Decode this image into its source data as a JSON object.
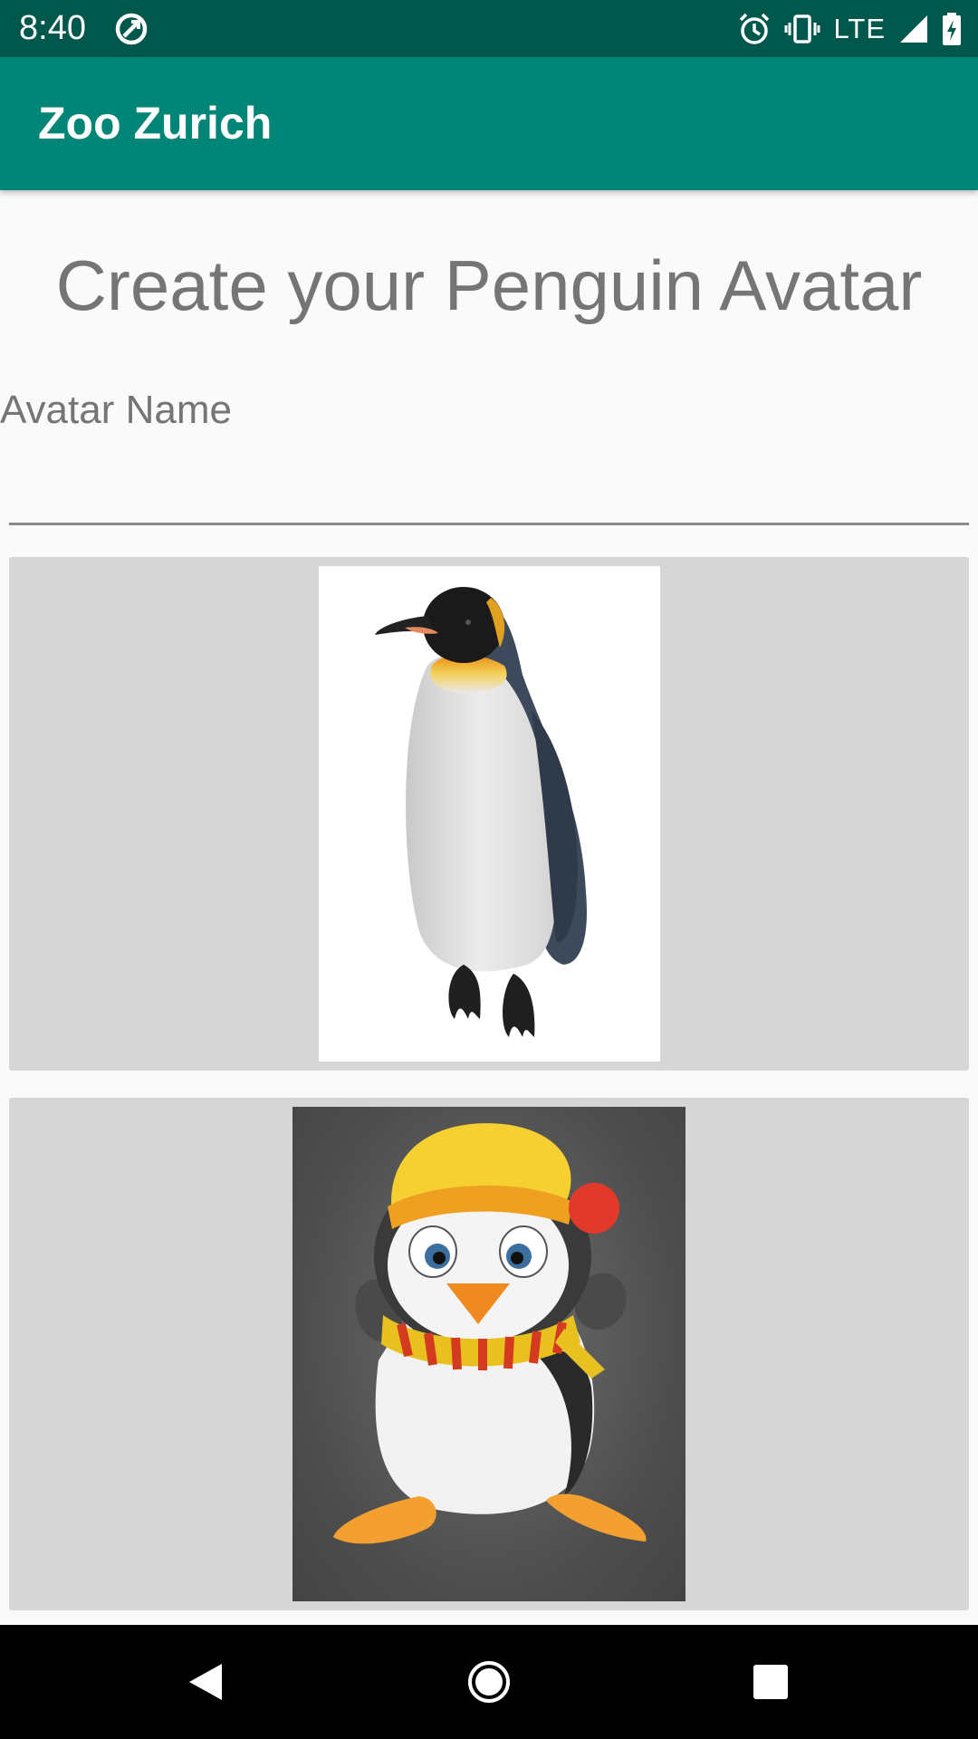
{
  "status_bar": {
    "time": "8:40",
    "network": "LTE",
    "icons": [
      "sync-icon",
      "alarm-icon",
      "vibrate-icon",
      "signal-icon",
      "battery-charging-icon"
    ]
  },
  "app_bar": {
    "title": "Zoo Zurich"
  },
  "main": {
    "heading": "Create your Penguin Avatar",
    "name_field": {
      "label": "Avatar Name",
      "value": ""
    },
    "avatars": [
      {
        "id": "emperor-penguin",
        "style": "realistic"
      },
      {
        "id": "cartoon-penguin",
        "style": "cartoon with hat and scarf"
      }
    ]
  },
  "nav_bar": {
    "buttons": [
      "back",
      "home",
      "recents"
    ]
  },
  "colors": {
    "status_bar": "#00574b",
    "app_bar": "#008577",
    "background": "#fafafa",
    "card": "#d6d6d6",
    "text_gray": "#757575"
  }
}
